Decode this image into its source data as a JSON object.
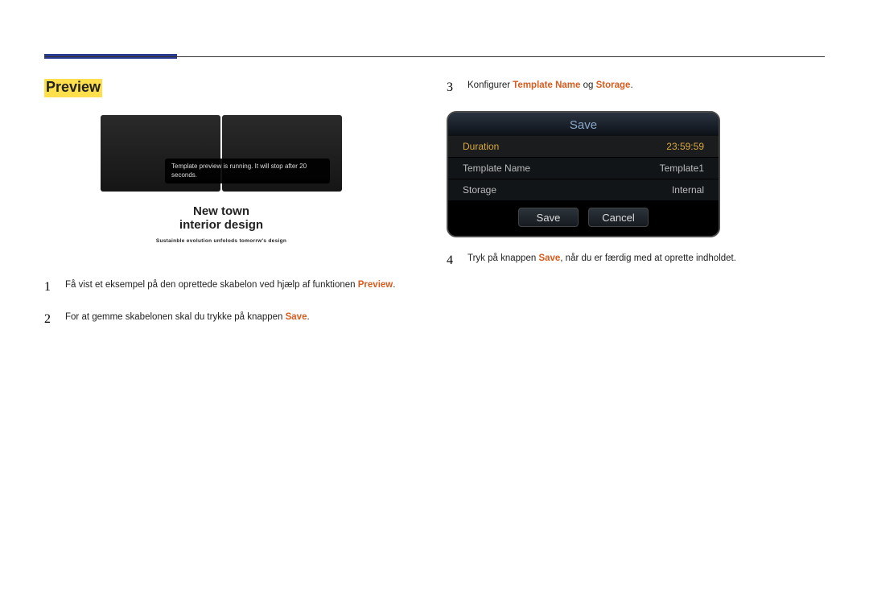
{
  "section_title": "Preview",
  "preview": {
    "toast": "Template preview is running. It will stop after 20 seconds.",
    "line1": "New town",
    "line2": "interior design",
    "line3": "Sustainble evolution unfolods tomorrw's design"
  },
  "steps": {
    "n1": "1",
    "s1_a": "Få vist et eksempel på den oprettede skabelon ved hjælp af funktionen ",
    "s1_b": "Preview",
    "s1_c": ".",
    "n2": "2",
    "s2_a": "For at gemme skabelonen skal du trykke på knappen ",
    "s2_b": "Save",
    "s2_c": ".",
    "n3": "3",
    "s3_a": "Konfigurer ",
    "s3_b": "Template Name",
    "s3_c": " og ",
    "s3_d": "Storage",
    "s3_e": ".",
    "n4": "4",
    "s4_a": "Tryk på knappen ",
    "s4_b": "Save",
    "s4_c": ", når du er færdig med at oprette indholdet."
  },
  "dialog": {
    "title": "Save",
    "rows": [
      {
        "label": "Duration",
        "value": "23:59:59"
      },
      {
        "label": "Template Name",
        "value": "Template1"
      },
      {
        "label": "Storage",
        "value": "Internal"
      }
    ],
    "save": "Save",
    "cancel": "Cancel"
  }
}
